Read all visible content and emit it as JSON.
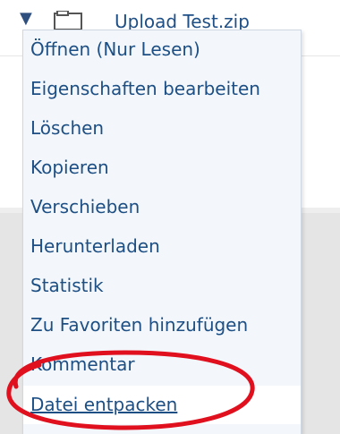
{
  "background_row": {
    "filename": "Upload Test.zip",
    "toggle_icon": "caret-down-icon",
    "folder_icon": "folder-icon"
  },
  "menu": {
    "items": [
      {
        "label": "Öffnen (Nur Lesen)"
      },
      {
        "label": "Eigenschaften bearbeiten"
      },
      {
        "label": "Löschen"
      },
      {
        "label": "Kopieren"
      },
      {
        "label": "Verschieben"
      },
      {
        "label": "Herunterladen"
      },
      {
        "label": "Statistik"
      },
      {
        "label": "Zu Favoriten hinzufügen"
      },
      {
        "label": "Kommentar"
      },
      {
        "label": "Datei entpacken"
      }
    ],
    "highlighted_item": "Datei entpacken"
  },
  "colors": {
    "link_blue": "#1d4f84",
    "menu_background": "#f3f7fb",
    "annotation_red": "#e0101e"
  }
}
